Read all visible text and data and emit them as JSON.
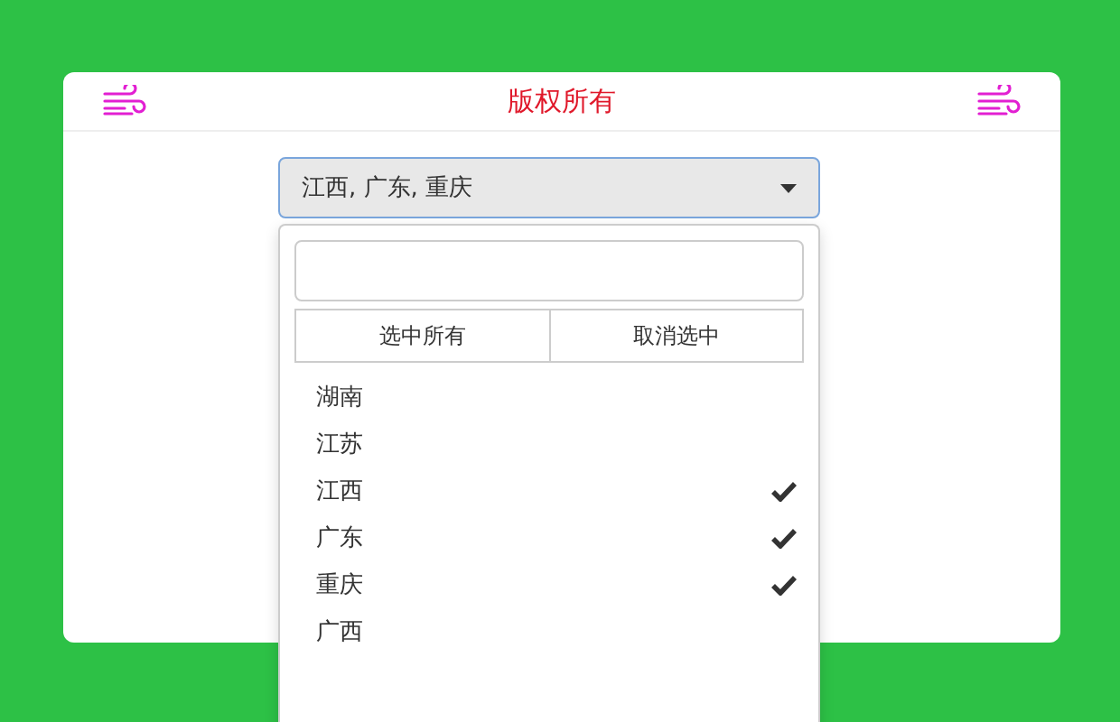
{
  "header": {
    "title": "版权所有"
  },
  "select": {
    "value": "江西, 广东, 重庆",
    "expanded": true
  },
  "menu": {
    "actions": [
      "选中所有",
      "取消选中"
    ],
    "options": [
      {
        "label": "湖南",
        "selected": false
      },
      {
        "label": "江苏",
        "selected": false
      },
      {
        "label": "江西",
        "selected": true
      },
      {
        "label": "广东",
        "selected": true
      },
      {
        "label": "重庆",
        "selected": true
      },
      {
        "label": "广西",
        "selected": false
      }
    ]
  }
}
